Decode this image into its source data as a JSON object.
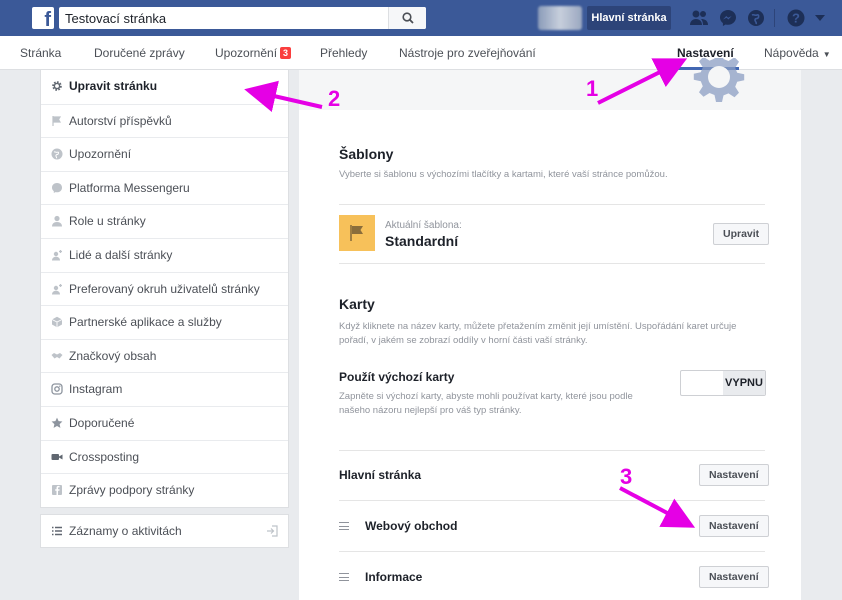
{
  "topbar": {
    "logo": "f",
    "search_value": "Testovací stránka",
    "home_label": "Hlavní stránka",
    "icons": [
      "friends-icon",
      "messenger-icon",
      "globe-icon",
      "help-icon",
      "caret-icon"
    ]
  },
  "nav": {
    "items": [
      {
        "label": "Stránka"
      },
      {
        "label": "Doručené zprávy"
      },
      {
        "label": "Upozornění",
        "badge": "3"
      },
      {
        "label": "Přehledy"
      },
      {
        "label": "Nástroje pro zveřejňování"
      },
      {
        "label": "Nastavení"
      },
      {
        "label": "Nápověda"
      }
    ],
    "active": "Nastavení"
  },
  "sidebar": {
    "items": [
      {
        "label": "Upravit stránku",
        "icon": "gear-icon",
        "active": true
      },
      {
        "label": "Autorství příspěvků",
        "icon": "flag-icon"
      },
      {
        "label": "Upozornění",
        "icon": "globe-icon"
      },
      {
        "label": "Platforma Messengeru",
        "icon": "messenger-icon"
      },
      {
        "label": "Role u stránky",
        "icon": "person-icon"
      },
      {
        "label": "Lidé a další stránky",
        "icon": "person-plus-icon"
      },
      {
        "label": "Preferovaný okruh uživatelů stránky",
        "icon": "person-plus-icon"
      },
      {
        "label": "Partnerské aplikace a služby",
        "icon": "cube-icon"
      },
      {
        "label": "Značkový obsah",
        "icon": "handshake-icon"
      },
      {
        "label": "Instagram",
        "icon": "instagram-icon"
      },
      {
        "label": "Doporučené",
        "icon": "star-icon"
      },
      {
        "label": "Crossposting",
        "icon": "video-icon"
      },
      {
        "label": "Zprávy podpory stránky",
        "icon": "facebook-icon"
      }
    ],
    "activity_log": "Záznamy o aktivitách"
  },
  "main": {
    "templates": {
      "title": "Šablony",
      "desc": "Vyberte si šablonu s výchozími tlačítky a kartami, které vaší stránce pomůžou.",
      "current_label": "Aktuální šablona:",
      "current_value": "Standardní",
      "edit_button": "Upravit"
    },
    "tabs": {
      "title": "Karty",
      "desc": "Když kliknete na název karty, můžete přetažením změnit její umístění. Uspořádání karet určuje pořadí, v jakém se zobrazí oddíly v horní části vaší stránky.",
      "default_title": "Použít výchozí karty",
      "default_desc": "Zapněte si výchozí karty, abyste mohli používat karty, které jsou podle našeho názoru nejlepší pro váš typ stránky.",
      "toggle_state": "VYPNU"
    },
    "rows": [
      {
        "label": "Hlavní stránka",
        "button": "Nastavení"
      },
      {
        "label": "Webový obchod",
        "button": "Nastavení"
      },
      {
        "label": "Informace",
        "button": "Nastavení"
      }
    ]
  },
  "annotations": {
    "one": "1",
    "two": "2",
    "three": "3",
    "color": "#e500e5"
  },
  "colors": {
    "brand": "#3b5998",
    "accent": "#4267b2",
    "badge": "#fa3e3e"
  }
}
